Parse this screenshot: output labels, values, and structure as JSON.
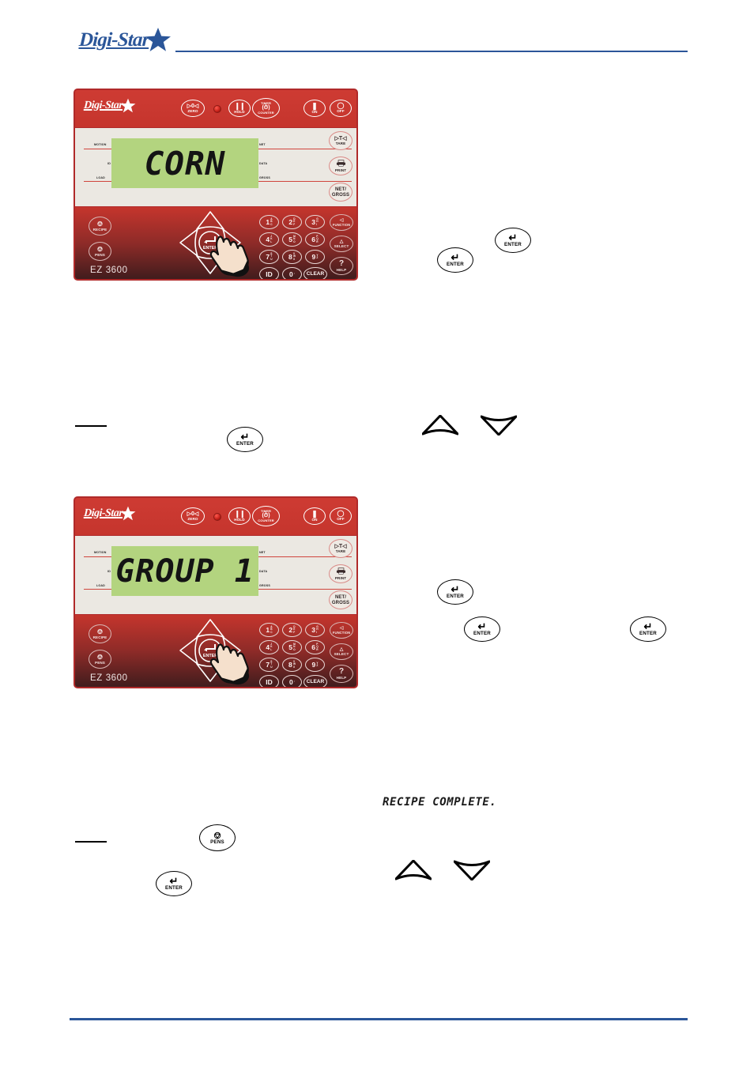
{
  "header": {
    "brand": "Digi-Star",
    "star_icon": "star-icon"
  },
  "device": {
    "model": "EZ 3600",
    "brand": "Digi-Star",
    "top_buttons": [
      {
        "name": "zero-button",
        "glyph": "▷◯◁",
        "label": "ZERO"
      },
      {
        "name": "hold-button",
        "glyph": "❙❙",
        "label": "HOLD"
      },
      {
        "name": "timer-counter-button",
        "glyph": "ⓘ",
        "label": "COUNTER",
        "label_top": "TIMER"
      },
      {
        "name": "on-button",
        "glyph": "❘",
        "label": "ON"
      },
      {
        "name": "off-button",
        "glyph": "◯",
        "label": "OFF"
      }
    ],
    "led_indicator": "power-led",
    "side_buttons": [
      {
        "name": "tare-button",
        "glyph": "▷T◁",
        "label": "TARE"
      },
      {
        "name": "print-button",
        "glyph": "printer",
        "label": "PRINT"
      },
      {
        "name": "net-gross-button",
        "glyph": "",
        "label": "NET/",
        "label2": "GROSS"
      }
    ],
    "left_buttons": [
      {
        "name": "recipe-button",
        "label": "RECIPE"
      },
      {
        "name": "pens-button",
        "label": "PENS"
      }
    ],
    "right_buttons": [
      {
        "name": "function-button",
        "glyph": "◁",
        "label": "FUNCTION"
      },
      {
        "name": "select-button",
        "glyph": "△",
        "label": "SELECT"
      },
      {
        "name": "help-button",
        "glyph": "?",
        "label": "HELP"
      }
    ],
    "keypad": [
      {
        "name": "key-1",
        "num": "1",
        "letters": "ABC"
      },
      {
        "name": "key-2",
        "num": "2",
        "letters": "DEF"
      },
      {
        "name": "key-3",
        "num": "3",
        "letters": "GHI"
      },
      {
        "name": "key-4",
        "num": "4",
        "letters": "JKL"
      },
      {
        "name": "key-5",
        "num": "5",
        "letters": "MNO"
      },
      {
        "name": "key-6",
        "num": "6",
        "letters": "PQR"
      },
      {
        "name": "key-7",
        "num": "7",
        "letters": "STU"
      },
      {
        "name": "key-8",
        "num": "8",
        "letters": "VWX"
      },
      {
        "name": "key-9",
        "num": "9",
        "letters": "YZ "
      },
      {
        "name": "key-id",
        "num": "ID",
        "letters": ""
      },
      {
        "name": "key-0",
        "num": "0",
        "letters": ":"
      },
      {
        "name": "key-clear",
        "num": "CLEAR",
        "letters": ""
      }
    ],
    "enter_label": "ENTER",
    "annunciators_left": [
      "MOTION",
      "ID",
      "LOAD"
    ],
    "annunciators_right": [
      "NET",
      "DATA",
      "GROSS"
    ]
  },
  "panels": [
    {
      "name": "panel-corn",
      "display": "CORN"
    },
    {
      "name": "panel-group-1",
      "display": "GROUP 1"
    }
  ],
  "inline_icons": {
    "enter_label": "ENTER",
    "pens_label": "PENS",
    "up_arrow": "up-arrow-icon",
    "down_arrow": "down-arrow-icon"
  },
  "messages": {
    "recipe_complete": "RECIPE COMPLETE."
  },
  "colors": {
    "brand_blue": "#2b5699",
    "panel_red": "#c5352d",
    "lcd_green": "#b3d47f",
    "led_red": "#c31f18"
  }
}
